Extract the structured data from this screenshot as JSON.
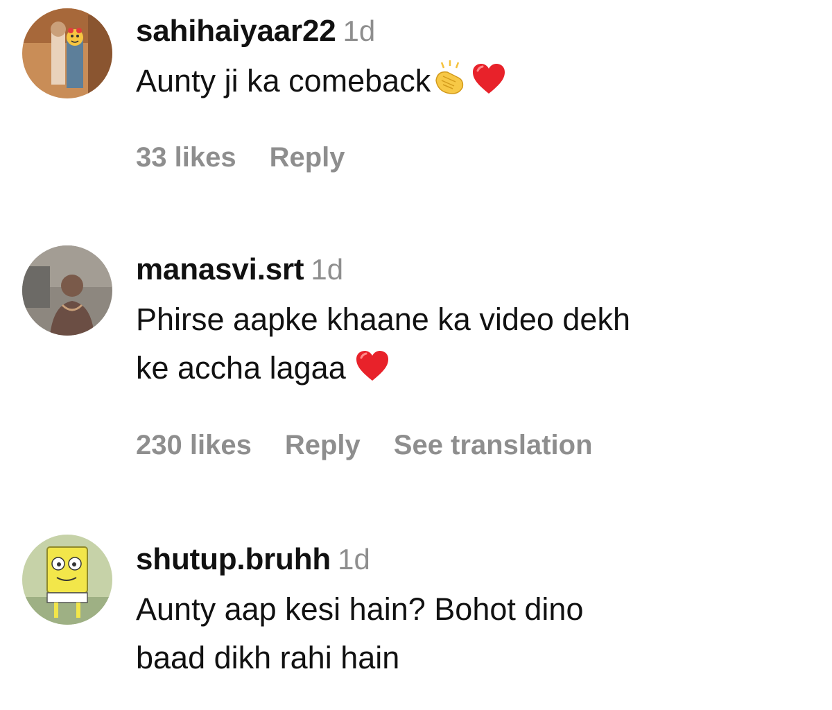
{
  "comments": [
    {
      "username": "sahihaiyaar22",
      "time": "1d",
      "text": "Aunty ji ka comeback",
      "emojis": [
        "clapping-hands-emoji",
        "red-heart-emoji"
      ],
      "likes": "33 likes",
      "reply": "Reply"
    },
    {
      "username": "manasvi.srt",
      "time": "1d",
      "text_line1": "Phirse aapke khaane ka video dekh",
      "text_line2": "ke accha lagaa",
      "emojis": [
        "red-heart-emoji"
      ],
      "likes": "230 likes",
      "reply": "Reply",
      "translation": "See translation"
    },
    {
      "username": "shutup.bruhh",
      "time": "1d",
      "text_line1": "Aunty aap kesi hain? Bohot dino",
      "text_line2": "baad dikh rahi hain"
    }
  ],
  "colors": {
    "text": "#111111",
    "muted": "#8e8e8e",
    "heart": "#e8222a"
  }
}
